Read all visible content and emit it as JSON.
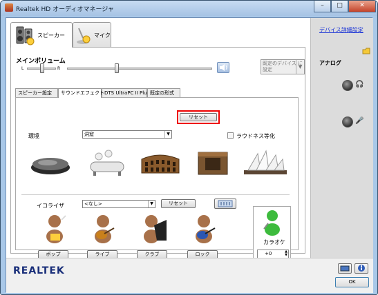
{
  "window": {
    "title": "Realtek HD オーディオマネージャ",
    "buttons": [
      "–",
      "□",
      "✕"
    ]
  },
  "device_tabs": [
    {
      "label": "スピーカー"
    },
    {
      "label": "マイク"
    }
  ],
  "volume": {
    "title": "メインボリューム",
    "left": "L",
    "right": "R",
    "set_default_label": "既定のデバイス に設定"
  },
  "subtabs": [
    "スピーカー設定",
    "サウンドエフェクト",
    "DTS UltraPC II Plus",
    "既定の形式"
  ],
  "environment": {
    "label": "環境",
    "value": "洞窟",
    "reset_label": "リセット",
    "loudness_label": "ラウドネス等化",
    "icons": [
      "stone",
      "bathtub",
      "colosseum",
      "stone-room",
      "opera-house"
    ]
  },
  "equalizer": {
    "label": "イコライザ",
    "value": "<なし>",
    "reset_label": "リセット",
    "presets": [
      "ポップ",
      "ライブ",
      "クラブ",
      "ロック"
    ]
  },
  "karaoke": {
    "label": "カラオケ",
    "value": "+0"
  },
  "sidebar": {
    "advanced_link": "デバイス詳細設定",
    "analog_label": "アナログ"
  },
  "brand": {
    "logo": "REALTEK"
  },
  "footer": {
    "ok_label": "OK"
  }
}
